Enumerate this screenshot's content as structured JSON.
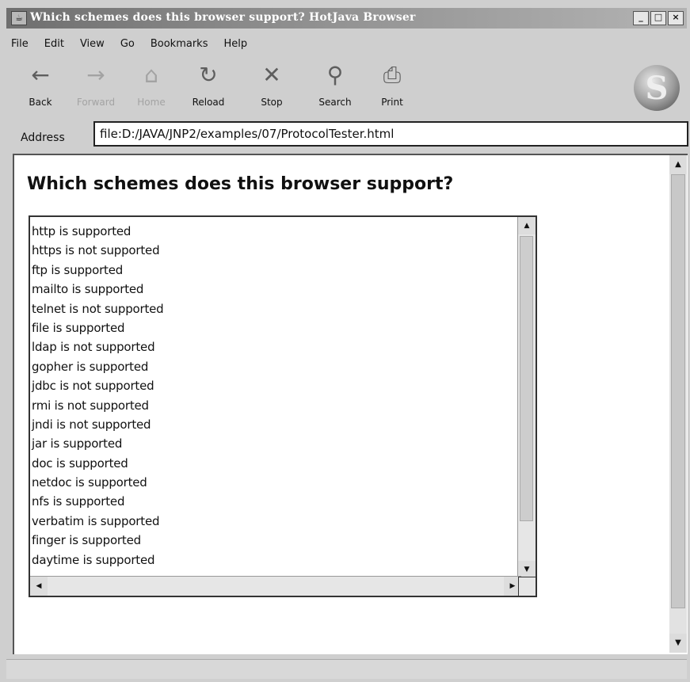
{
  "window": {
    "title": "Which schemes does this browser support? HotJava Browser",
    "minimize_glyph": "_",
    "maximize_glyph": "□",
    "close_glyph": "×"
  },
  "menu": [
    "File",
    "Edit",
    "View",
    "Go",
    "Bookmarks",
    "Help"
  ],
  "toolbar": {
    "back": {
      "label": "Back",
      "icon": "back-arrow-icon",
      "glyph": "←"
    },
    "forward": {
      "label": "Forward",
      "icon": "forward-arrow-icon",
      "glyph": "→"
    },
    "home": {
      "label": "Home",
      "icon": "home-icon",
      "glyph": "⌂"
    },
    "reload": {
      "label": "Reload",
      "icon": "reload-icon",
      "glyph": "↻"
    },
    "stop": {
      "label": "Stop",
      "icon": "stop-icon",
      "glyph": "✕"
    },
    "search": {
      "label": "Search",
      "icon": "search-icon",
      "glyph": "⚲"
    },
    "print": {
      "label": "Print",
      "icon": "print-icon",
      "glyph": "⎙"
    }
  },
  "address": {
    "label": "Address",
    "value": "file:D:/JAVA/JNP2/examples/07/ProtocolTester.html"
  },
  "page": {
    "heading": "Which schemes does this browser support?"
  },
  "results": [
    "http is supported",
    "https is not supported",
    "ftp is supported",
    "mailto is supported",
    "telnet is not supported",
    "file is supported",
    "ldap is not supported",
    "gopher is supported",
    "jdbc is not supported",
    "rmi is not supported",
    "jndi is not supported",
    "jar is supported",
    "doc is supported",
    "netdoc is supported",
    "nfs is supported",
    "verbatim is supported",
    "finger is supported",
    "daytime is supported"
  ],
  "logo_letter": "S",
  "colors": {
    "window_bg": "#cfcfcf",
    "content_bg": "#ffffff",
    "titlebar": "#7a7a7a"
  }
}
